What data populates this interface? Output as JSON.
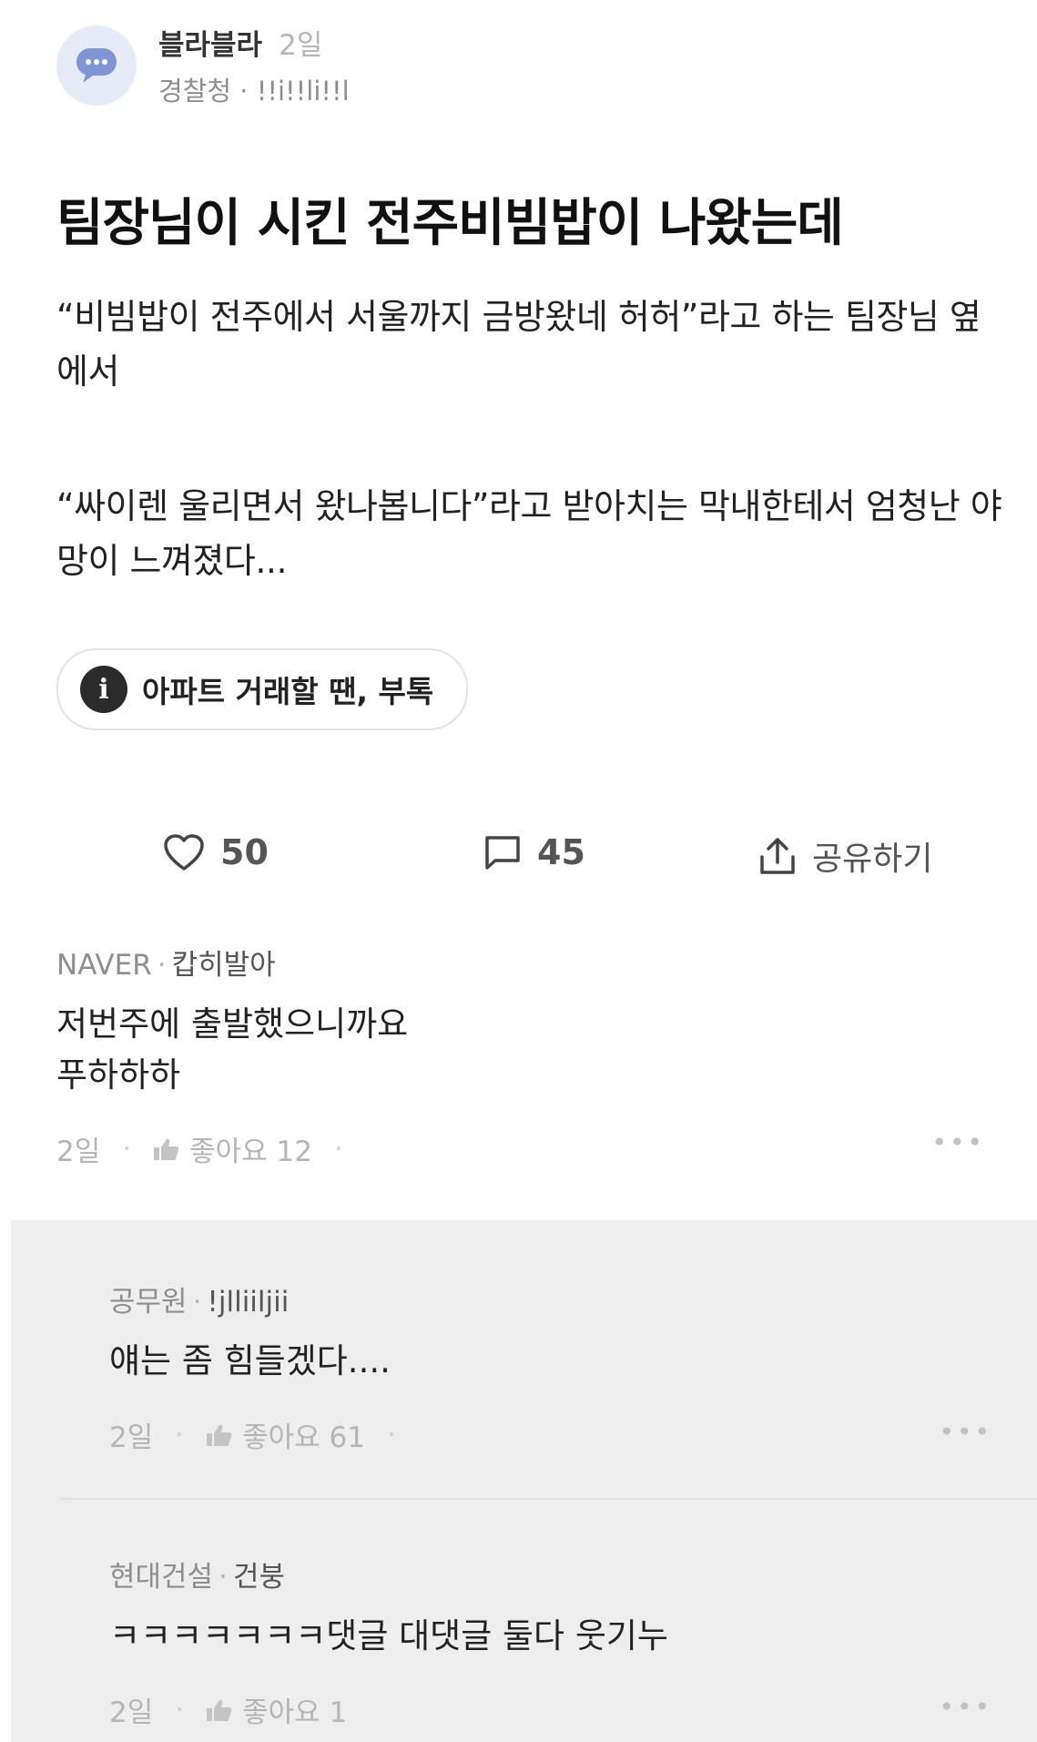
{
  "post": {
    "author": "블라블라",
    "time": "2일",
    "company": "경찰청",
    "separator": "·",
    "handle": "!!i!!li!!l",
    "title": "팀장님이 시킨 전주비빔밥이 나왔는데",
    "paragraph1": "“비빔밥이 전주에서 서울까지 금방왔네 허허”라고 하는 팀장님 옆에서",
    "paragraph2": "“싸이렌 울리면서 왔나봅니다”라고 받아치는 막내한테서 엄청난 야망이 느껴졌다..."
  },
  "ad": {
    "icon": "info-icon",
    "text": "아파트 거래할 땐, 부톡"
  },
  "actions": {
    "likes": "50",
    "comments": "45",
    "share_label": "공유하기"
  },
  "comments": [
    {
      "company": "NAVER",
      "nick": "캅히발아",
      "text": "저번주에 출발했으니까요\n푸하하하",
      "time": "2일",
      "likes_label": "좋아요 12"
    }
  ],
  "replies": [
    {
      "company": "공무원",
      "nick": "!jlliiljii",
      "text": "얘는 좀 힘들겠다....",
      "time": "2일",
      "likes_label": "좋아요 61"
    },
    {
      "company": "현대건설",
      "nick": "건붕",
      "text": "ㅋㅋㅋㅋㅋㅋㅋ댓글 대댓글 둘다 웃기누",
      "time": "2일",
      "likes_label": "좋아요 1"
    }
  ],
  "colors": {
    "avatar_bg": "#e6ebf7",
    "avatar_icon": "#7f96d6",
    "reply_bg": "#eeeeee"
  }
}
